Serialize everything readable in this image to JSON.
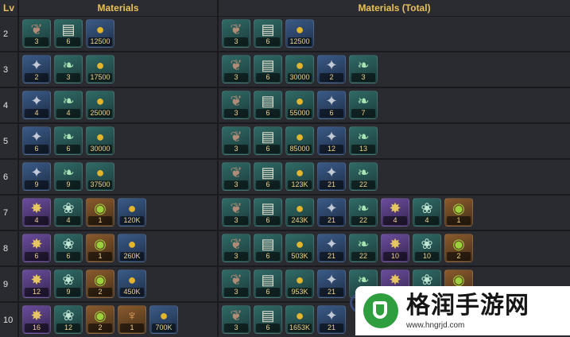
{
  "header": {
    "lv": "Lv",
    "materials": "Materials",
    "materials_total": "Materials (Total)"
  },
  "rows": [
    {
      "lv": "2",
      "mat": [
        {
          "icon": "wing",
          "bg": "teal",
          "q": "3"
        },
        {
          "icon": "scroll",
          "bg": "teal",
          "q": "6"
        },
        {
          "icon": "coin",
          "bg": "blue",
          "q": "12500"
        }
      ],
      "tot": [
        {
          "icon": "wing",
          "bg": "teal",
          "q": "3"
        },
        {
          "icon": "scroll",
          "bg": "teal",
          "q": "6"
        },
        {
          "icon": "coin",
          "bg": "blue",
          "q": "12500"
        }
      ]
    },
    {
      "lv": "3",
      "mat": [
        {
          "icon": "silver",
          "bg": "blue",
          "q": "2"
        },
        {
          "icon": "green",
          "bg": "teal",
          "q": "3"
        },
        {
          "icon": "coin",
          "bg": "teal",
          "q": "17500"
        }
      ],
      "tot": [
        {
          "icon": "wing",
          "bg": "teal",
          "q": "3"
        },
        {
          "icon": "scroll",
          "bg": "teal",
          "q": "6"
        },
        {
          "icon": "coin",
          "bg": "teal",
          "q": "30000"
        },
        {
          "icon": "silver",
          "bg": "blue",
          "q": "2"
        },
        {
          "icon": "green",
          "bg": "teal",
          "q": "3"
        }
      ]
    },
    {
      "lv": "4",
      "mat": [
        {
          "icon": "silver",
          "bg": "blue",
          "q": "4"
        },
        {
          "icon": "green",
          "bg": "teal",
          "q": "4"
        },
        {
          "icon": "coin",
          "bg": "teal",
          "q": "25000"
        }
      ],
      "tot": [
        {
          "icon": "wing",
          "bg": "teal",
          "q": "3"
        },
        {
          "icon": "scroll",
          "bg": "teal",
          "q": "6"
        },
        {
          "icon": "coin",
          "bg": "teal",
          "q": "55000"
        },
        {
          "icon": "silver",
          "bg": "blue",
          "q": "6"
        },
        {
          "icon": "green",
          "bg": "teal",
          "q": "7"
        }
      ]
    },
    {
      "lv": "5",
      "mat": [
        {
          "icon": "silver",
          "bg": "blue",
          "q": "6"
        },
        {
          "icon": "green",
          "bg": "teal",
          "q": "6"
        },
        {
          "icon": "coin",
          "bg": "teal",
          "q": "30000"
        }
      ],
      "tot": [
        {
          "icon": "wing",
          "bg": "teal",
          "q": "3"
        },
        {
          "icon": "scroll",
          "bg": "teal",
          "q": "6"
        },
        {
          "icon": "coin",
          "bg": "teal",
          "q": "85000"
        },
        {
          "icon": "silver",
          "bg": "blue",
          "q": "12"
        },
        {
          "icon": "green",
          "bg": "teal",
          "q": "13"
        }
      ]
    },
    {
      "lv": "6",
      "mat": [
        {
          "icon": "silver",
          "bg": "blue",
          "q": "9"
        },
        {
          "icon": "green",
          "bg": "teal",
          "q": "9"
        },
        {
          "icon": "coin",
          "bg": "teal",
          "q": "37500"
        }
      ],
      "tot": [
        {
          "icon": "wing",
          "bg": "teal",
          "q": "3"
        },
        {
          "icon": "scroll",
          "bg": "teal",
          "q": "6"
        },
        {
          "icon": "coin",
          "bg": "teal",
          "q": "123K"
        },
        {
          "icon": "silver",
          "bg": "blue",
          "q": "21"
        },
        {
          "icon": "green",
          "bg": "teal",
          "q": "22"
        }
      ]
    },
    {
      "lv": "7",
      "mat": [
        {
          "icon": "gold",
          "bg": "purple",
          "q": "4"
        },
        {
          "icon": "bird",
          "bg": "teal",
          "q": "4"
        },
        {
          "icon": "orb",
          "bg": "orange",
          "q": "1"
        },
        {
          "icon": "coin",
          "bg": "blue",
          "q": "120K"
        }
      ],
      "tot": [
        {
          "icon": "wing",
          "bg": "teal",
          "q": "3"
        },
        {
          "icon": "scroll",
          "bg": "teal",
          "q": "6"
        },
        {
          "icon": "coin",
          "bg": "teal",
          "q": "243K"
        },
        {
          "icon": "silver",
          "bg": "blue",
          "q": "21"
        },
        {
          "icon": "green",
          "bg": "teal",
          "q": "22"
        },
        {
          "icon": "gold",
          "bg": "purple",
          "q": "4"
        },
        {
          "icon": "bird",
          "bg": "teal",
          "q": "4"
        },
        {
          "icon": "orb",
          "bg": "orange",
          "q": "1"
        }
      ]
    },
    {
      "lv": "8",
      "mat": [
        {
          "icon": "gold",
          "bg": "purple",
          "q": "6"
        },
        {
          "icon": "bird",
          "bg": "teal",
          "q": "6"
        },
        {
          "icon": "orb",
          "bg": "orange",
          "q": "1"
        },
        {
          "icon": "coin",
          "bg": "blue",
          "q": "260K"
        }
      ],
      "tot": [
        {
          "icon": "wing",
          "bg": "teal",
          "q": "3"
        },
        {
          "icon": "scroll",
          "bg": "teal",
          "q": "6"
        },
        {
          "icon": "coin",
          "bg": "teal",
          "q": "503K"
        },
        {
          "icon": "silver",
          "bg": "blue",
          "q": "21"
        },
        {
          "icon": "green",
          "bg": "teal",
          "q": "22"
        },
        {
          "icon": "gold",
          "bg": "purple",
          "q": "10"
        },
        {
          "icon": "bird",
          "bg": "teal",
          "q": "10"
        },
        {
          "icon": "orb",
          "bg": "orange",
          "q": "2"
        }
      ]
    },
    {
      "lv": "9",
      "mat": [
        {
          "icon": "gold",
          "bg": "purple",
          "q": "12"
        },
        {
          "icon": "bird",
          "bg": "teal",
          "q": "9"
        },
        {
          "icon": "orb",
          "bg": "orange",
          "q": "2"
        },
        {
          "icon": "coin",
          "bg": "blue",
          "q": "450K"
        }
      ],
      "tot": [
        {
          "icon": "wing",
          "bg": "teal",
          "q": "3"
        },
        {
          "icon": "scroll",
          "bg": "teal",
          "q": "6"
        },
        {
          "icon": "coin",
          "bg": "teal",
          "q": "953K"
        },
        {
          "icon": "silver",
          "bg": "blue",
          "q": "21"
        },
        {
          "icon": "green",
          "bg": "teal",
          "q": ""
        },
        {
          "icon": "gold",
          "bg": "purple",
          "q": ""
        },
        {
          "icon": "bird",
          "bg": "teal",
          "q": ""
        },
        {
          "icon": "orb",
          "bg": "orange",
          "q": ""
        }
      ]
    },
    {
      "lv": "10",
      "mat": [
        {
          "icon": "gold",
          "bg": "purple",
          "q": "16"
        },
        {
          "icon": "bird",
          "bg": "teal",
          "q": "12"
        },
        {
          "icon": "orb",
          "bg": "orange",
          "q": "2"
        },
        {
          "icon": "trophy",
          "bg": "orange",
          "q": "1"
        },
        {
          "icon": "coin",
          "bg": "blue",
          "q": "700K"
        }
      ],
      "tot": [
        {
          "icon": "wing",
          "bg": "teal",
          "q": "3"
        },
        {
          "icon": "scroll",
          "bg": "teal",
          "q": "6"
        },
        {
          "icon": "coin",
          "bg": "teal",
          "q": "1653K"
        },
        {
          "icon": "silver",
          "bg": "blue",
          "q": "21"
        }
      ]
    }
  ],
  "watermark": {
    "name": "格润手游网",
    "url": "www.hngrjd.com"
  }
}
